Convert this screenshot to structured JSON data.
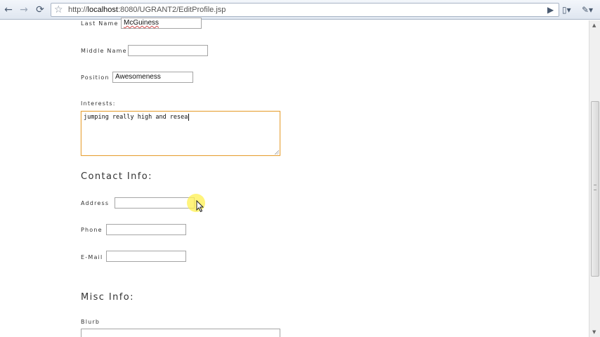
{
  "browser": {
    "url_prefix": "http://",
    "url_host": "localhost",
    "url_rest": ":8080/UGRANT2/EditProfile.jsp",
    "icons": {
      "back": "back-arrow-icon",
      "forward": "forward-arrow-icon",
      "reload": "reload-icon",
      "bookmark": "star-icon",
      "go": "play-icon",
      "page_menu": "page-menu-icon",
      "tools_menu": "wrench-icon"
    }
  },
  "form": {
    "last_name": {
      "label": "Last Name",
      "value": "McGuiness"
    },
    "middle_name": {
      "label": "Middle Name",
      "value": ""
    },
    "position": {
      "label": "Position",
      "value": "Awesomeness"
    },
    "interests": {
      "label": "Interests:",
      "value": "jumping really high and resea"
    }
  },
  "contact": {
    "title": "Contact Info:",
    "address": {
      "label": "Address",
      "value": ""
    },
    "phone": {
      "label": "Phone",
      "value": ""
    },
    "email": {
      "label": "E-Mail",
      "value": ""
    }
  },
  "misc": {
    "title": "Misc Info:",
    "blurb": {
      "label": "Blurb"
    }
  },
  "colors": {
    "focus_border": "#e8a33c",
    "cursor_highlight": "#fff050"
  }
}
